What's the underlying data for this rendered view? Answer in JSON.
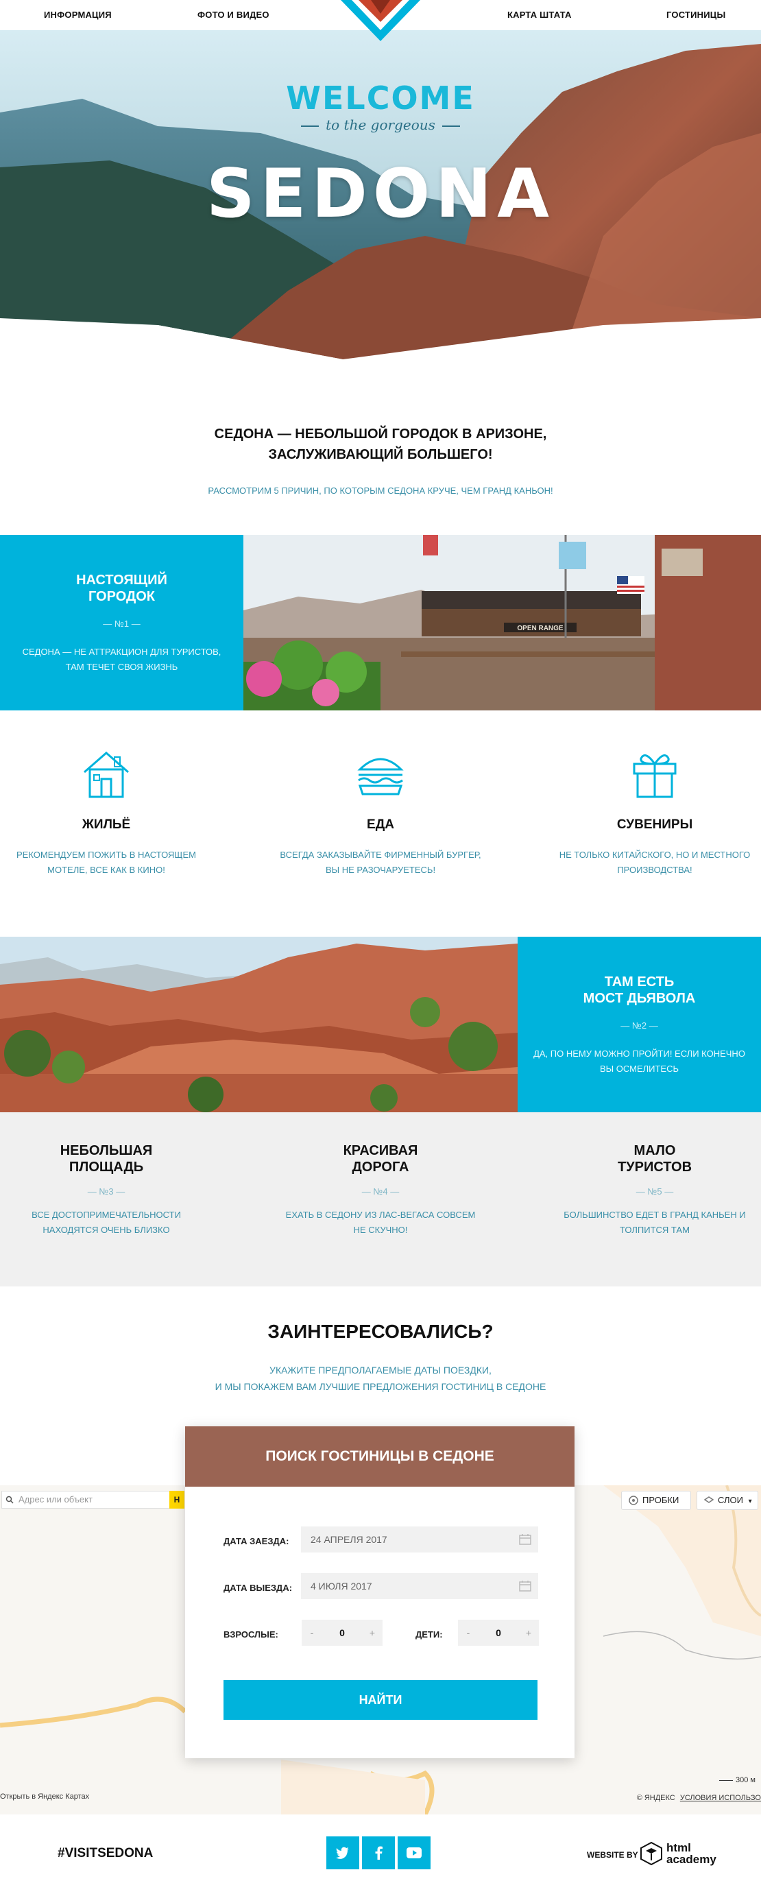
{
  "nav": {
    "items": [
      "ИНФОРМАЦИЯ",
      "ФОТО И ВИДЕО",
      "КАРТА ШТАТА",
      "ГОСТИНИЦЫ"
    ]
  },
  "hero": {
    "welcome": "WELCOME",
    "gorgeous": "to the gorgeous",
    "sedona": "SEDONA"
  },
  "intro": {
    "title_line1": "СЕДОНА — НЕБОЛЬШОЙ ГОРОДОК В АРИЗОНЕ,",
    "title_line2": "ЗАСЛУЖИВАЮЩИЙ БОЛЬШЕГО!",
    "subtitle": "РАССМОТРИМ 5 ПРИЧИН, ПО КОТОРЫМ СЕДОНА КРУЧЕ, ЧЕМ ГРАНД КАНЬОН!"
  },
  "feature1": {
    "title_line1": "НАСТОЯЩИЙ",
    "title_line2": "ГОРОДОК",
    "number": "— №1 —",
    "desc_line1": "СЕДОНА — НЕ АТТРАКЦИОН ДЛЯ ТУРИСТОВ,",
    "desc_line2": "ТАМ ТЕЧЕТ СВОЯ ЖИЗНЬ",
    "sign": "OPEN RANGE"
  },
  "amenities": [
    {
      "title": "ЖИЛЬЁ",
      "desc_line1": "РЕКОМЕНДУЕМ ПОЖИТЬ В НАСТОЯЩЕМ",
      "desc_line2": "МОТЕЛЕ, ВСЕ КАК В КИНО!",
      "icon": "house-icon"
    },
    {
      "title": "ЕДА",
      "desc_line1": "ВСЕГДА ЗАКАЗЫВАЙТЕ ФИРМЕННЫЙ БУРГЕР,",
      "desc_line2": "ВЫ НЕ РАЗОЧАРУЕТЕСЬ!",
      "icon": "burger-icon"
    },
    {
      "title": "СУВЕНИРЫ",
      "desc_line1": "НЕ ТОЛЬКО КИТАЙСКОГО, НО И МЕСТНОГО",
      "desc_line2": "ПРОИЗВОДСТВА!",
      "icon": "gift-icon"
    }
  ],
  "feature2": {
    "title_line1": "ТАМ ЕСТЬ",
    "title_line2": "МОСТ ДЬЯВОЛА",
    "number": "— №2 —",
    "desc_line1": "ДА, ПО НЕМУ МОЖНО ПРОЙТИ! ЕСЛИ КОНЕЧНО",
    "desc_line2": "ВЫ ОСМЕЛИТЕСЬ"
  },
  "reasons": [
    {
      "title_line1": "НЕБОЛЬШАЯ",
      "title_line2": "ПЛОЩАДЬ",
      "number": "— №3 —",
      "desc_line1": "ВСЕ ДОСТОПРИМЕЧАТЕЛЬНОСТИ",
      "desc_line2": "НАХОДЯТСЯ ОЧЕНЬ БЛИЗКО"
    },
    {
      "title_line1": "КРАСИВАЯ",
      "title_line2": "ДОРОГА",
      "number": "— №4 —",
      "desc_line1": "ЕХАТЬ В СЕДОНУ ИЗ ЛАС-ВЕГАСА СОВСЕМ",
      "desc_line2": "НЕ СКУЧНО!"
    },
    {
      "title_line1": "МАЛО",
      "title_line2": "ТУРИСТОВ",
      "number": "— №5 —",
      "desc_line1": "БОЛЬШИНСТВО ЕДЕТ В ГРАНД КАНЬЕН И",
      "desc_line2": "ТОЛПИТСЯ ТАМ"
    }
  ],
  "interested": {
    "title": "ЗАИНТЕРЕСОВАЛИСЬ?",
    "sub_line1": "УКАЖИТЕ ПРЕДПОЛАГАЕМЫЕ ДАТЫ ПОЕЗДКИ,",
    "sub_line2": "И МЫ ПОКАЖЕМ ВАМ ЛУЧШИЕ ПРЕДЛОЖЕНИЯ ГОСТИНИЦ В СЕДОНЕ"
  },
  "map": {
    "search_placeholder": "Адрес или объект",
    "search_btn": "Н",
    "traffic": "ПРОБКИ",
    "layers": "СЛОИ",
    "open_link": "Открыть в Яндекс Картах",
    "scale": "300 м",
    "copyright": "© ЯНДЕКС",
    "terms": "УСЛОВИЯ ИСПОЛЬЗО"
  },
  "search": {
    "title": "ПОИСК ГОСТИНИЦЫ В СЕДОНЕ",
    "checkin_label": "ДАТА ЗАЕЗДА:",
    "checkin_value": "24 АПРЕЛЯ 2017",
    "checkout_label": "ДАТА ВЫЕЗДА:",
    "checkout_value": "4 ИЮЛЯ 2017",
    "adults_label": "ВЗРОСЛЫЕ:",
    "adults_value": "0",
    "children_label": "ДЕТИ:",
    "children_value": "0",
    "minus": "-",
    "plus": "+",
    "submit": "НАЙТИ"
  },
  "footer": {
    "hashtag": "#VISITSEDONA",
    "website_by": "WEBSITE BY",
    "academy_line1": "html",
    "academy_line2": "academy",
    "social": [
      "twitter-icon",
      "facebook-icon",
      "youtube-icon"
    ]
  },
  "colors": {
    "accent": "#00b3dc",
    "card_header": "#9a6453",
    "muted_text": "#3a8fa8",
    "grey_bg": "#f0f0f0"
  }
}
